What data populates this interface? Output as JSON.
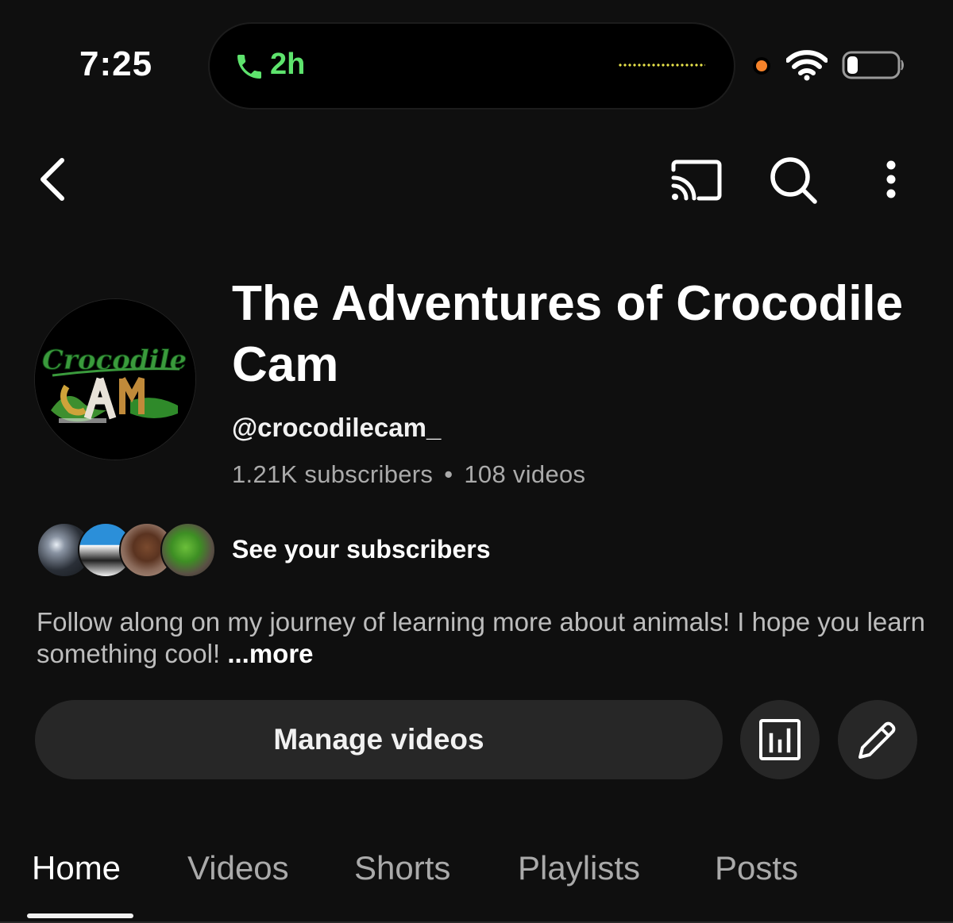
{
  "status_bar": {
    "time": "7:25",
    "call_duration": "2h",
    "accent_green": "#5ee36d",
    "recording_dot_color": "#f5822a"
  },
  "top_nav": {
    "icons": [
      "back-icon",
      "cast-icon",
      "search-icon",
      "more-vert-icon"
    ]
  },
  "channel": {
    "title": "The Adventures of Crocodile Cam",
    "handle": "@crocodilecam_",
    "subscribers": "1.21K subscribers",
    "separator": "•",
    "videos": "108 videos",
    "avatar_logo_text": "Crocodile"
  },
  "subscribers_row": {
    "label": "See your subscribers"
  },
  "description": {
    "text": "Follow along on my journey of learning more about animals! I hope you learn something cool!",
    "more_label": "...more"
  },
  "actions": {
    "manage_label": "Manage videos",
    "analytics_icon": "analytics-icon",
    "edit_icon": "edit-pencil-icon"
  },
  "tabs": [
    {
      "label": "Home",
      "active": true
    },
    {
      "label": "Videos",
      "active": false
    },
    {
      "label": "Shorts",
      "active": false
    },
    {
      "label": "Playlists",
      "active": false
    },
    {
      "label": "Posts",
      "active": false
    }
  ],
  "colors": {
    "background": "#0f0f0f",
    "surface": "#272727",
    "text_primary": "#f1f1f1",
    "text_secondary": "#aaaaaa"
  }
}
